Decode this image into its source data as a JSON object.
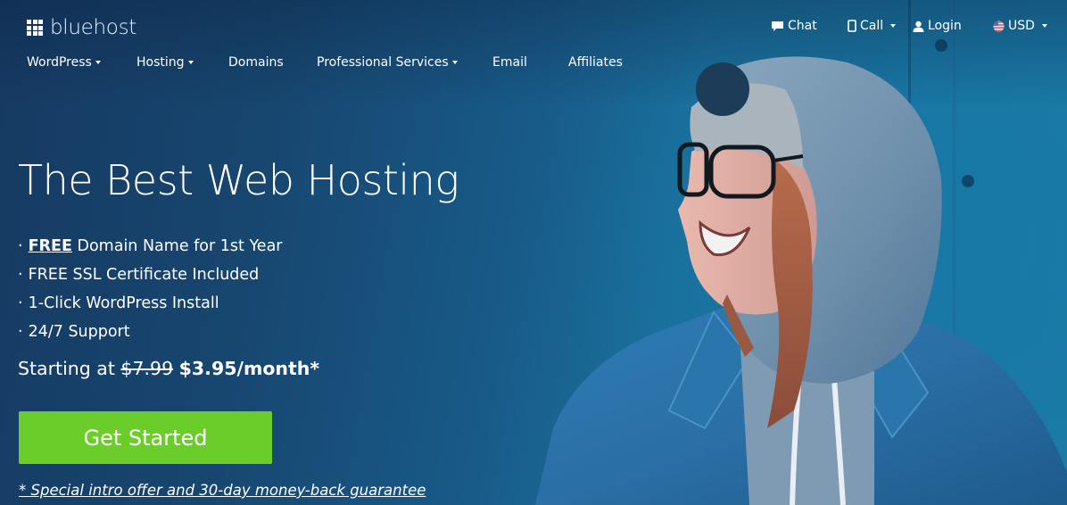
{
  "brand": {
    "name": "bluehost",
    "logo_icon": "grid-3x3-icon"
  },
  "topbar": {
    "items": [
      {
        "label": "Chat",
        "icon": "speech-bubble-icon",
        "has_dropdown": false
      },
      {
        "label": "Call",
        "icon": "mobile-phone-icon",
        "has_dropdown": true
      },
      {
        "label": "Login",
        "icon": "user-icon",
        "has_dropdown": false
      },
      {
        "label": "USD",
        "icon": "us-flag-icon",
        "has_dropdown": true
      }
    ]
  },
  "nav": {
    "items": [
      {
        "label": "WordPress",
        "has_dropdown": true
      },
      {
        "label": "Hosting",
        "has_dropdown": true
      },
      {
        "label": "Domains",
        "has_dropdown": false
      },
      {
        "label": "Professional Services",
        "has_dropdown": true
      },
      {
        "label": "Email",
        "has_dropdown": false
      },
      {
        "label": "Affiliates",
        "has_dropdown": false
      }
    ]
  },
  "hero": {
    "title": "The Best Web Hosting",
    "bullet": "·",
    "features": [
      {
        "emphasis": "FREE",
        "text": " Domain Name for 1st Year"
      },
      {
        "emphasis": "",
        "text": "FREE SSL Certificate Included"
      },
      {
        "emphasis": "",
        "text": "1-Click WordPress Install"
      },
      {
        "emphasis": "",
        "text": "24/7 Support"
      }
    ],
    "price": {
      "prefix": "Starting at ",
      "old_price": "$7.99",
      "new_price": "$3.95/month*"
    },
    "cta_label": "Get Started",
    "disclaimer": "* Special intro offer and 30-day money-back guarantee",
    "image_description": "Smiling woman with glasses wearing a grey hoodie and denim jacket against a blue wall"
  },
  "colors": {
    "cta_green": "#6acd29",
    "background_dark": "#163a62",
    "background_light": "#1b7aa6",
    "text": "#ffffff"
  }
}
